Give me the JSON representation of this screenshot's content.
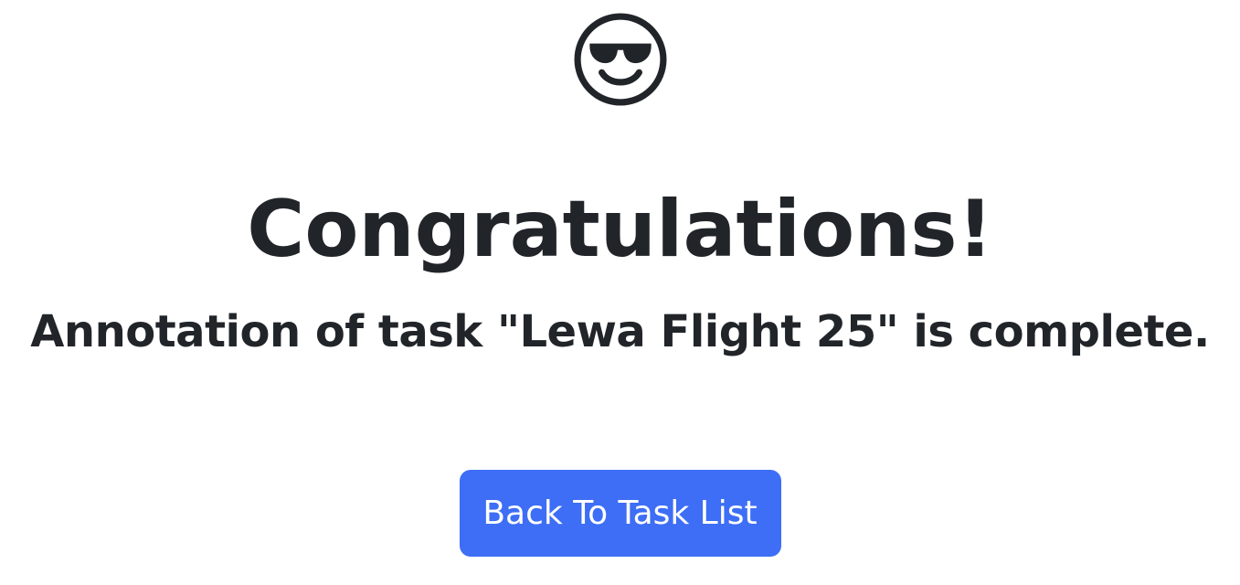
{
  "header": {
    "icon": "smiling-face-with-sunglasses-icon"
  },
  "main": {
    "title": "Congratulations!",
    "message": "Annotation of task \"Lewa Flight 25\" is complete.",
    "back_button_label": "Back To Task List"
  },
  "colors": {
    "text": "#212529",
    "button_bg": "#3d6ef5",
    "button_text": "#ffffff"
  }
}
